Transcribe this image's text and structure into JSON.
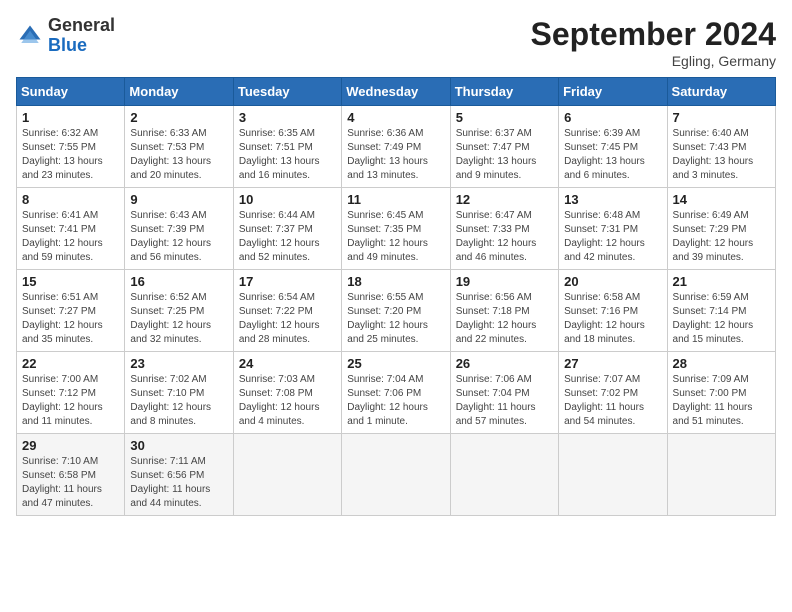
{
  "header": {
    "logo": {
      "general": "General",
      "blue": "Blue"
    },
    "title": "September 2024",
    "location": "Egling, Germany"
  },
  "calendar": {
    "weekdays": [
      "Sunday",
      "Monday",
      "Tuesday",
      "Wednesday",
      "Thursday",
      "Friday",
      "Saturday"
    ],
    "weeks": [
      [
        {
          "day": "1",
          "sunrise": "Sunrise: 6:32 AM",
          "sunset": "Sunset: 7:55 PM",
          "daylight": "Daylight: 13 hours and 23 minutes."
        },
        {
          "day": "2",
          "sunrise": "Sunrise: 6:33 AM",
          "sunset": "Sunset: 7:53 PM",
          "daylight": "Daylight: 13 hours and 20 minutes."
        },
        {
          "day": "3",
          "sunrise": "Sunrise: 6:35 AM",
          "sunset": "Sunset: 7:51 PM",
          "daylight": "Daylight: 13 hours and 16 minutes."
        },
        {
          "day": "4",
          "sunrise": "Sunrise: 6:36 AM",
          "sunset": "Sunset: 7:49 PM",
          "daylight": "Daylight: 13 hours and 13 minutes."
        },
        {
          "day": "5",
          "sunrise": "Sunrise: 6:37 AM",
          "sunset": "Sunset: 7:47 PM",
          "daylight": "Daylight: 13 hours and 9 minutes."
        },
        {
          "day": "6",
          "sunrise": "Sunrise: 6:39 AM",
          "sunset": "Sunset: 7:45 PM",
          "daylight": "Daylight: 13 hours and 6 minutes."
        },
        {
          "day": "7",
          "sunrise": "Sunrise: 6:40 AM",
          "sunset": "Sunset: 7:43 PM",
          "daylight": "Daylight: 13 hours and 3 minutes."
        }
      ],
      [
        {
          "day": "8",
          "sunrise": "Sunrise: 6:41 AM",
          "sunset": "Sunset: 7:41 PM",
          "daylight": "Daylight: 12 hours and 59 minutes."
        },
        {
          "day": "9",
          "sunrise": "Sunrise: 6:43 AM",
          "sunset": "Sunset: 7:39 PM",
          "daylight": "Daylight: 12 hours and 56 minutes."
        },
        {
          "day": "10",
          "sunrise": "Sunrise: 6:44 AM",
          "sunset": "Sunset: 7:37 PM",
          "daylight": "Daylight: 12 hours and 52 minutes."
        },
        {
          "day": "11",
          "sunrise": "Sunrise: 6:45 AM",
          "sunset": "Sunset: 7:35 PM",
          "daylight": "Daylight: 12 hours and 49 minutes."
        },
        {
          "day": "12",
          "sunrise": "Sunrise: 6:47 AM",
          "sunset": "Sunset: 7:33 PM",
          "daylight": "Daylight: 12 hours and 46 minutes."
        },
        {
          "day": "13",
          "sunrise": "Sunrise: 6:48 AM",
          "sunset": "Sunset: 7:31 PM",
          "daylight": "Daylight: 12 hours and 42 minutes."
        },
        {
          "day": "14",
          "sunrise": "Sunrise: 6:49 AM",
          "sunset": "Sunset: 7:29 PM",
          "daylight": "Daylight: 12 hours and 39 minutes."
        }
      ],
      [
        {
          "day": "15",
          "sunrise": "Sunrise: 6:51 AM",
          "sunset": "Sunset: 7:27 PM",
          "daylight": "Daylight: 12 hours and 35 minutes."
        },
        {
          "day": "16",
          "sunrise": "Sunrise: 6:52 AM",
          "sunset": "Sunset: 7:25 PM",
          "daylight": "Daylight: 12 hours and 32 minutes."
        },
        {
          "day": "17",
          "sunrise": "Sunrise: 6:54 AM",
          "sunset": "Sunset: 7:22 PM",
          "daylight": "Daylight: 12 hours and 28 minutes."
        },
        {
          "day": "18",
          "sunrise": "Sunrise: 6:55 AM",
          "sunset": "Sunset: 7:20 PM",
          "daylight": "Daylight: 12 hours and 25 minutes."
        },
        {
          "day": "19",
          "sunrise": "Sunrise: 6:56 AM",
          "sunset": "Sunset: 7:18 PM",
          "daylight": "Daylight: 12 hours and 22 minutes."
        },
        {
          "day": "20",
          "sunrise": "Sunrise: 6:58 AM",
          "sunset": "Sunset: 7:16 PM",
          "daylight": "Daylight: 12 hours and 18 minutes."
        },
        {
          "day": "21",
          "sunrise": "Sunrise: 6:59 AM",
          "sunset": "Sunset: 7:14 PM",
          "daylight": "Daylight: 12 hours and 15 minutes."
        }
      ],
      [
        {
          "day": "22",
          "sunrise": "Sunrise: 7:00 AM",
          "sunset": "Sunset: 7:12 PM",
          "daylight": "Daylight: 12 hours and 11 minutes."
        },
        {
          "day": "23",
          "sunrise": "Sunrise: 7:02 AM",
          "sunset": "Sunset: 7:10 PM",
          "daylight": "Daylight: 12 hours and 8 minutes."
        },
        {
          "day": "24",
          "sunrise": "Sunrise: 7:03 AM",
          "sunset": "Sunset: 7:08 PM",
          "daylight": "Daylight: 12 hours and 4 minutes."
        },
        {
          "day": "25",
          "sunrise": "Sunrise: 7:04 AM",
          "sunset": "Sunset: 7:06 PM",
          "daylight": "Daylight: 12 hours and 1 minute."
        },
        {
          "day": "26",
          "sunrise": "Sunrise: 7:06 AM",
          "sunset": "Sunset: 7:04 PM",
          "daylight": "Daylight: 11 hours and 57 minutes."
        },
        {
          "day": "27",
          "sunrise": "Sunrise: 7:07 AM",
          "sunset": "Sunset: 7:02 PM",
          "daylight": "Daylight: 11 hours and 54 minutes."
        },
        {
          "day": "28",
          "sunrise": "Sunrise: 7:09 AM",
          "sunset": "Sunset: 7:00 PM",
          "daylight": "Daylight: 11 hours and 51 minutes."
        }
      ],
      [
        {
          "day": "29",
          "sunrise": "Sunrise: 7:10 AM",
          "sunset": "Sunset: 6:58 PM",
          "daylight": "Daylight: 11 hours and 47 minutes."
        },
        {
          "day": "30",
          "sunrise": "Sunrise: 7:11 AM",
          "sunset": "Sunset: 6:56 PM",
          "daylight": "Daylight: 11 hours and 44 minutes."
        },
        null,
        null,
        null,
        null,
        null
      ]
    ]
  }
}
